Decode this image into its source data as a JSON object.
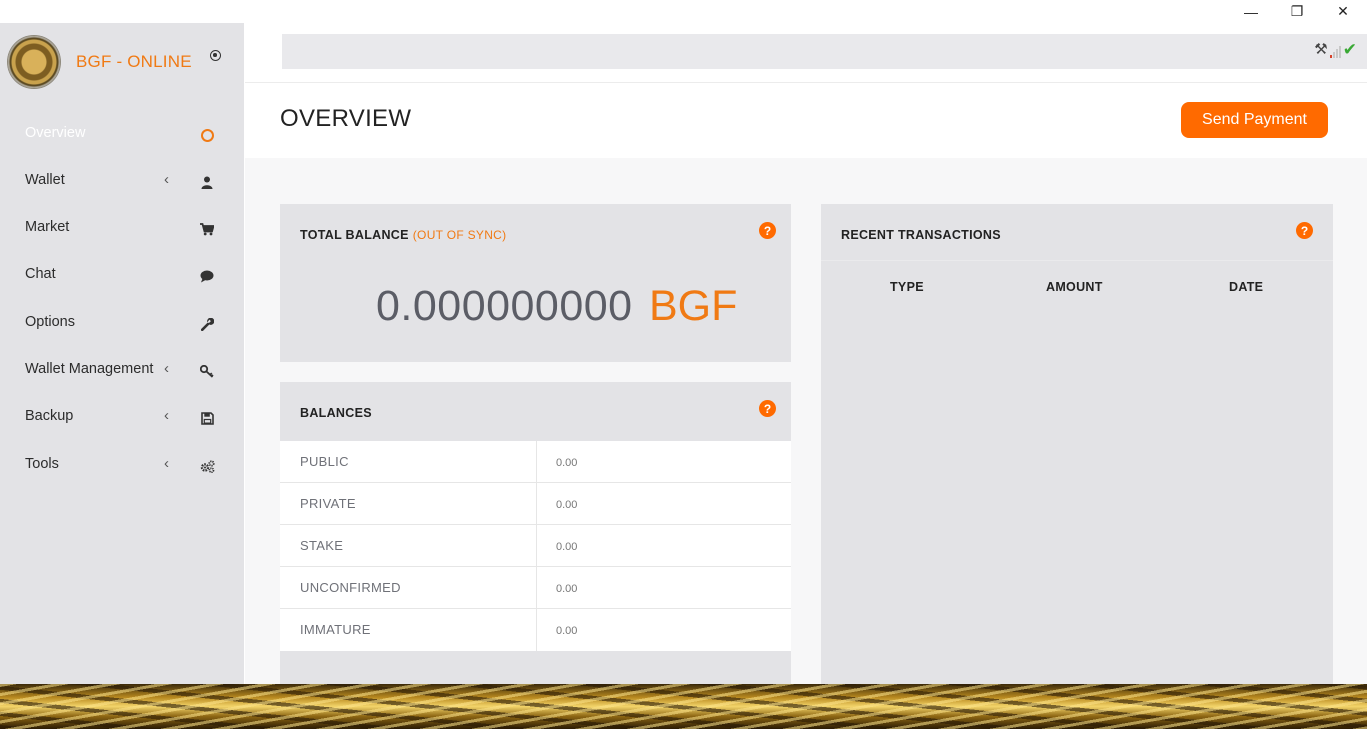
{
  "window": {
    "minimize_glyph": "—",
    "maximize_glyph": "❐",
    "close_glyph": "✕"
  },
  "sidebar": {
    "brand": "BGF - ONLINE",
    "items": [
      {
        "label": "Overview",
        "icon": "ring-icon",
        "submenu": false,
        "active": true
      },
      {
        "label": "Wallet",
        "icon": "user-icon",
        "submenu": true
      },
      {
        "label": "Market",
        "icon": "cart-icon",
        "submenu": false
      },
      {
        "label": "Chat",
        "icon": "chat-bubble-icon",
        "submenu": false
      },
      {
        "label": "Options",
        "icon": "wrench-icon",
        "submenu": false
      },
      {
        "label": "Wallet Management",
        "icon": "key-icon",
        "submenu": true
      },
      {
        "label": "Backup",
        "icon": "floppy-disk-icon",
        "submenu": true
      },
      {
        "label": "Tools",
        "icon": "gears-icon",
        "submenu": true
      }
    ],
    "chevron": "‹"
  },
  "header": {
    "title": "OVERVIEW",
    "send_button": "Send Payment"
  },
  "total_balance": {
    "title": "TOTAL BALANCE",
    "sync_status": "(OUT OF SYNC)",
    "amount": "0.000000000",
    "currency": "BGF",
    "help": "?"
  },
  "balances": {
    "title": "BALANCES",
    "help": "?",
    "rows": [
      {
        "label": "PUBLIC",
        "value": "0.00"
      },
      {
        "label": "PRIVATE",
        "value": "0.00"
      },
      {
        "label": "STAKE",
        "value": "0.00"
      },
      {
        "label": "UNCONFIRMED",
        "value": "0.00"
      },
      {
        "label": "IMMATURE",
        "value": "0.00"
      }
    ]
  },
  "recent_transactions": {
    "title": "RECENT TRANSACTIONS",
    "help": "?",
    "columns": [
      "TYPE",
      "AMOUNT",
      "DATE"
    ]
  },
  "status": {
    "mining_icon": "hammers-icon",
    "signal_icon": "signal-bars-icon",
    "sync_icon": "checkmark-icon",
    "accent": "#ff6a00",
    "ok_color": "#3aa935"
  }
}
